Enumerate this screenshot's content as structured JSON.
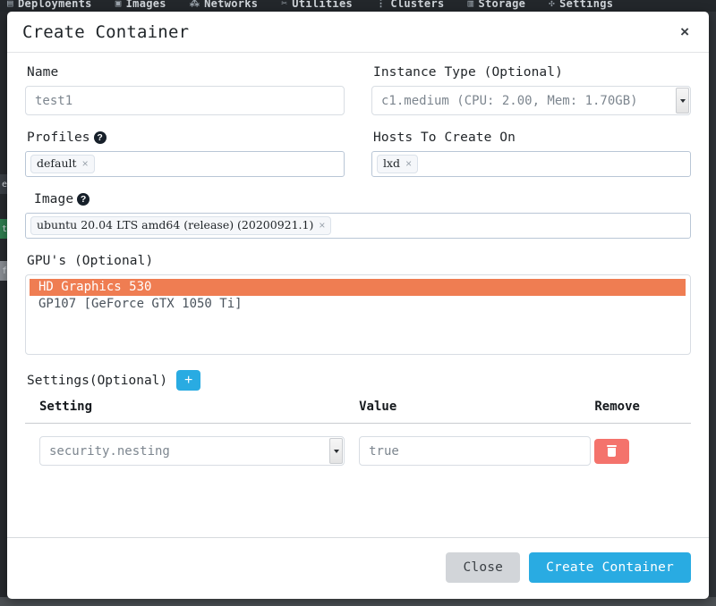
{
  "background": {
    "nav_items": [
      {
        "icon": "server-icon",
        "label": "Deployments"
      },
      {
        "icon": "image-icon",
        "label": "Images"
      },
      {
        "icon": "network-icon",
        "label": "Networks"
      },
      {
        "icon": "wrench-icon",
        "label": "Utilities"
      },
      {
        "icon": "cluster-icon",
        "label": "Clusters"
      },
      {
        "icon": "storage-icon",
        "label": "Storage"
      },
      {
        "icon": "gear-icon",
        "label": "Settings"
      }
    ],
    "chips": [
      {
        "label": "e",
        "color": "#3a3f45"
      },
      {
        "label": "t",
        "color": "#2f7d4f"
      },
      {
        "label": "f",
        "color": "#8a8f94"
      }
    ]
  },
  "modal": {
    "title": "Create Container",
    "close_icon": "×",
    "help_icon": "?",
    "fields": {
      "name": {
        "label": "Name",
        "value": "test1",
        "placeholder": "test1"
      },
      "instance_type": {
        "label": "Instance Type (Optional)",
        "value": "c1.medium (CPU: 2.00, Mem: 1.70GB)"
      },
      "profiles": {
        "label": "Profiles",
        "tags": [
          "default"
        ]
      },
      "hosts": {
        "label": "Hosts To Create On",
        "tags": [
          "lxd"
        ]
      },
      "image": {
        "label": "Image",
        "tags": [
          "ubuntu 20.04 LTS amd64 (release) (20200921.1)"
        ]
      },
      "gpus": {
        "label": "GPU's (Optional)",
        "options": [
          {
            "label": "HD Graphics 530",
            "selected": true
          },
          {
            "label": "GP107 [GeForce GTX 1050 Ti]",
            "selected": false
          }
        ],
        "selected_color": "#ef7d52"
      }
    },
    "settings": {
      "label": "Settings(Optional)",
      "add_label": "+",
      "add_color": "#29abe2",
      "columns": [
        "Setting",
        "Value",
        "Remove"
      ],
      "rows": [
        {
          "setting": "security.nesting",
          "value": "true",
          "remove_icon": "trash-icon",
          "remove_color": "#f4736c"
        }
      ]
    },
    "footer": {
      "close_label": "Close",
      "create_label": "Create Container",
      "close_color": "#d2d5d9",
      "create_color": "#29abe2"
    },
    "tag_remove_glyph": "×"
  }
}
